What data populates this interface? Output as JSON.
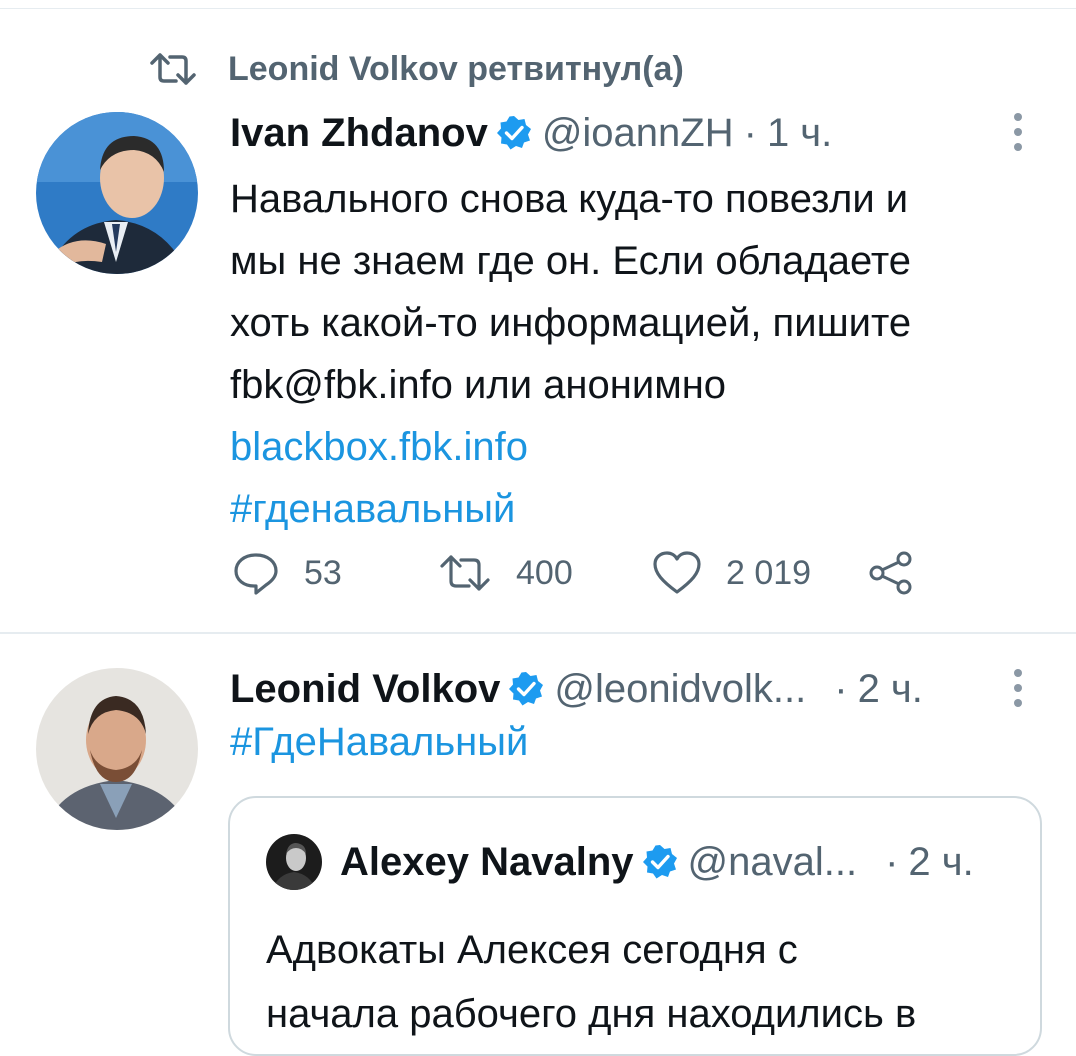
{
  "retweet_header": {
    "text": "Leonid Volkov ретвитнул(а)"
  },
  "tweet1": {
    "author_name": "Ivan Zhdanov",
    "handle": "@ioannZH",
    "separator": "·",
    "time": "1 ч.",
    "text_lines": [
      "Навального снова куда-то повезли и",
      "мы не знаем где он. Если обладаете",
      "хоть какой-то информацией, пишите",
      "fbk@fbk.info или анонимно"
    ],
    "link": "blackbox.fbk.info",
    "hashtag": "#гденавальный",
    "replies": "53",
    "retweets": "400",
    "likes": "2 019"
  },
  "tweet2": {
    "author_name": "Leonid Volkov",
    "handle": "@leonidvolk...",
    "separator": "·",
    "time": "2 ч.",
    "hashtag": "#ГдеНавальный",
    "quoted": {
      "author_name": "Alexey Navalny",
      "handle": "@naval...",
      "separator": "·",
      "time": "2 ч.",
      "text_lines": [
        "Адвокаты Алексея сегодня с",
        "начала рабочего дня находились в"
      ]
    }
  },
  "colors": {
    "link": "#1b95e0",
    "verified": "#1d9bf0",
    "muted": "#536471"
  }
}
